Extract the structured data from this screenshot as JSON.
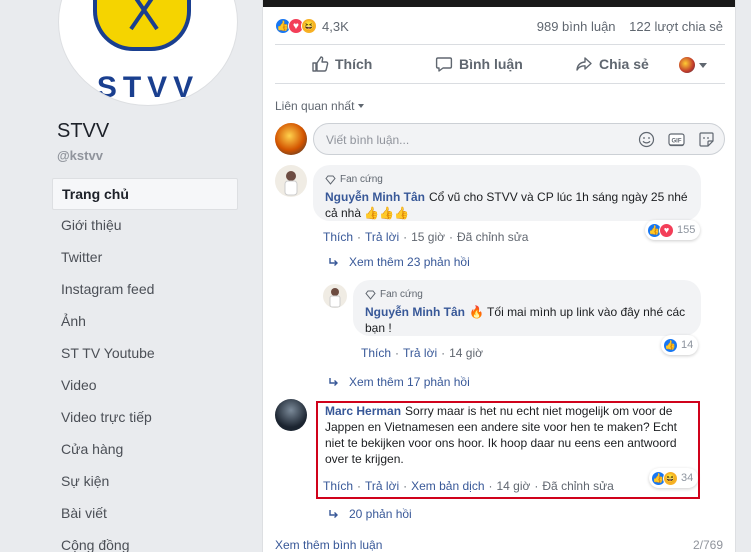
{
  "sidebar": {
    "logo_text": "STVV",
    "page_name": "STVV",
    "page_handle": "@kstvv",
    "items": [
      {
        "label": "Trang chủ",
        "active": true
      },
      {
        "label": "Giới thiệu"
      },
      {
        "label": "Twitter"
      },
      {
        "label": "Instagram feed"
      },
      {
        "label": "Ảnh"
      },
      {
        "label": "ST TV Youtube"
      },
      {
        "label": "Video"
      },
      {
        "label": "Video trực tiếp"
      },
      {
        "label": "Cửa hàng"
      },
      {
        "label": "Sự kiện"
      },
      {
        "label": "Bài viết"
      },
      {
        "label": "Cộng đồng"
      }
    ]
  },
  "post": {
    "reaction_count": "4,3K",
    "comments_count": "989 bình luận",
    "shares_count": "122 lượt chia sẻ",
    "actions": {
      "like": "Thích",
      "comment": "Bình luận",
      "share": "Chia sẻ"
    },
    "sort_label": "Liên quan nhất",
    "composer_placeholder": "Viết bình luận...",
    "see_more_comments": "Xem thêm bình luận",
    "comments_page": "2/769"
  },
  "comments": [
    {
      "badge": "Fan cứng",
      "author": "Nguyễn Minh Tân",
      "text": "Cổ vũ cho STVV và CP lúc 1h sáng ngày 25 nhé cả nhà 👍👍👍",
      "like": "Thích",
      "reply": "Trả lời",
      "time": "15 giờ",
      "edited": "Đã chỉnh sửa",
      "reactions": "155",
      "more_replies": "Xem thêm 23 phản hồi"
    },
    {
      "badge": "Fan cứng",
      "author": "Nguyễn Minh Tân",
      "text": "🔥 Tối mai mình up link vào đây nhé các bạn !",
      "like": "Thích",
      "reply": "Trả lời",
      "time": "14 giờ",
      "reactions": "14",
      "more_replies": "Xem thêm 17 phản hồi"
    },
    {
      "author": "Marc Herman",
      "text": "Sorry maar is het nu echt niet mogelijk om voor de Jappen en Vietnamesen een andere site voor hen te maken? Echt niet te bekijken voor ons hoor. Ik hoop daar nu eens een antwoord over te krijgen.",
      "like": "Thích",
      "reply": "Trả lời",
      "translate": "Xem bản dịch",
      "time": "14 giờ",
      "edited": "Đã chỉnh sửa",
      "reactions": "34",
      "more_replies": "20 phản hồi"
    }
  ],
  "colors": {
    "link": "#385898",
    "highlight_border": "#d0021b",
    "like_blue": "#1877f2"
  }
}
